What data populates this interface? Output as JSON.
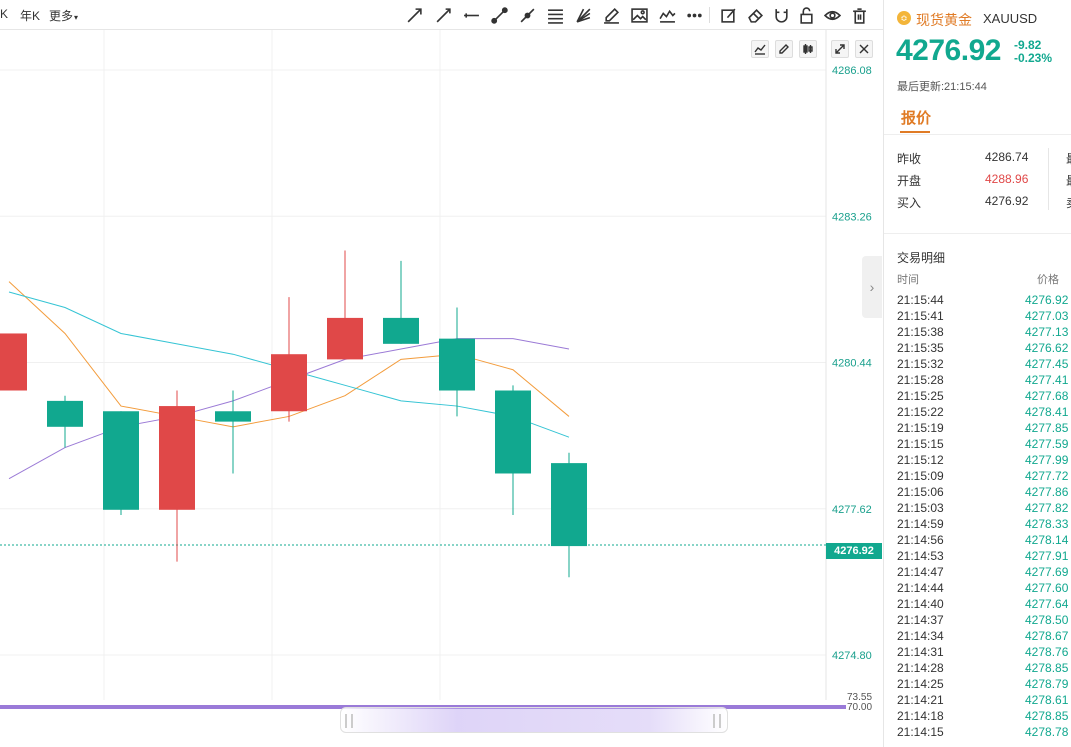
{
  "toolbar": {
    "periods": [
      "K",
      "年K"
    ],
    "more_label": "更多"
  },
  "chart_data": {
    "type": "candlestick",
    "price_axis": [
      "4286.08",
      "4283.26",
      "4280.44",
      "4277.62",
      "4274.80"
    ],
    "current_price_label": "4276.92",
    "indicator_labels": [
      "73.55",
      "70.00"
    ],
    "ylim": [
      4274.0,
      4286.9
    ],
    "candles": [
      {
        "open": 4279.9,
        "close": 4281.0,
        "high": 4281.0,
        "low": 4279.9
      },
      {
        "open": 4279.7,
        "close": 4279.2,
        "high": 4279.8,
        "low": 4278.8
      },
      {
        "open": 4279.5,
        "close": 4277.6,
        "high": 4279.5,
        "low": 4277.5
      },
      {
        "open": 4277.6,
        "close": 4279.6,
        "high": 4279.9,
        "low": 4276.6
      },
      {
        "open": 4279.5,
        "close": 4279.3,
        "high": 4279.9,
        "low": 4278.3
      },
      {
        "open": 4279.5,
        "close": 4280.6,
        "high": 4281.7,
        "low": 4279.3
      },
      {
        "open": 4280.5,
        "close": 4281.3,
        "high": 4282.6,
        "low": 4280.5
      },
      {
        "open": 4281.3,
        "close": 4280.8,
        "high": 4282.4,
        "low": 4280.8
      },
      {
        "open": 4280.9,
        "close": 4279.9,
        "high": 4281.5,
        "low": 4279.4
      },
      {
        "open": 4279.9,
        "close": 4278.3,
        "high": 4280.0,
        "low": 4277.5
      },
      {
        "open": 4278.5,
        "close": 4276.9,
        "high": 4278.7,
        "low": 4276.3
      }
    ],
    "ma_series": [
      {
        "color": "#f39c3c",
        "values": [
          4282.0,
          4281.0,
          4279.6,
          4279.4,
          4279.2,
          4279.4,
          4279.8,
          4280.5,
          4280.6,
          4280.3,
          4279.4
        ]
      },
      {
        "color": "#35c4d4",
        "values": [
          4281.8,
          4281.5,
          4281.0,
          4280.8,
          4280.6,
          4280.3,
          4280.0,
          4279.7,
          4279.6,
          4279.4,
          4279.0
        ]
      },
      {
        "color": "#9b7ad6",
        "values": [
          4278.2,
          4278.8,
          4279.2,
          4279.4,
          4279.7,
          4280.1,
          4280.5,
          4280.7,
          4280.9,
          4280.9,
          4280.7
        ]
      }
    ]
  },
  "quote": {
    "icon_symbol": "≎",
    "name": "现货黄金",
    "code": "XAUUSD",
    "last": "4276.92",
    "change": "-9.82",
    "change_pct": "-0.23%",
    "update_time": "最后更新:21:15:44",
    "tab_label": "报价",
    "rows": [
      {
        "label": "昨收",
        "value": "4286.74",
        "trunc": "最"
      },
      {
        "label": "开盘",
        "value": "4288.96",
        "trunc": "最"
      },
      {
        "label": "买入",
        "value": "4276.92",
        "trunc": "卖"
      }
    ]
  },
  "trades": {
    "title": "交易明细",
    "col_time": "时间",
    "col_price": "价格",
    "rows": [
      {
        "time": "21:15:44",
        "price": "4276.92"
      },
      {
        "time": "21:15:41",
        "price": "4277.03"
      },
      {
        "time": "21:15:38",
        "price": "4277.13"
      },
      {
        "time": "21:15:35",
        "price": "4276.62"
      },
      {
        "time": "21:15:32",
        "price": "4277.45"
      },
      {
        "time": "21:15:28",
        "price": "4277.41"
      },
      {
        "time": "21:15:25",
        "price": "4277.68"
      },
      {
        "time": "21:15:22",
        "price": "4278.41"
      },
      {
        "time": "21:15:19",
        "price": "4277.85"
      },
      {
        "time": "21:15:15",
        "price": "4277.59"
      },
      {
        "time": "21:15:12",
        "price": "4277.99"
      },
      {
        "time": "21:15:09",
        "price": "4277.72"
      },
      {
        "time": "21:15:06",
        "price": "4277.86"
      },
      {
        "time": "21:15:03",
        "price": "4277.82"
      },
      {
        "time": "21:14:59",
        "price": "4278.33"
      },
      {
        "time": "21:14:56",
        "price": "4278.14"
      },
      {
        "time": "21:14:53",
        "price": "4277.91"
      },
      {
        "time": "21:14:47",
        "price": "4277.69"
      },
      {
        "time": "21:14:44",
        "price": "4277.60"
      },
      {
        "time": "21:14:40",
        "price": "4277.64"
      },
      {
        "time": "21:14:37",
        "price": "4278.50"
      },
      {
        "time": "21:14:34",
        "price": "4278.67"
      },
      {
        "time": "21:14:31",
        "price": "4278.76"
      },
      {
        "time": "21:14:28",
        "price": "4278.85"
      },
      {
        "time": "21:14:25",
        "price": "4278.79"
      },
      {
        "time": "21:14:21",
        "price": "4278.61"
      },
      {
        "time": "21:14:18",
        "price": "4278.85"
      },
      {
        "time": "21:14:15",
        "price": "4278.78"
      }
    ]
  },
  "colors": {
    "up": "#e04848",
    "down": "#11a88f",
    "accent": "#e07b25"
  }
}
